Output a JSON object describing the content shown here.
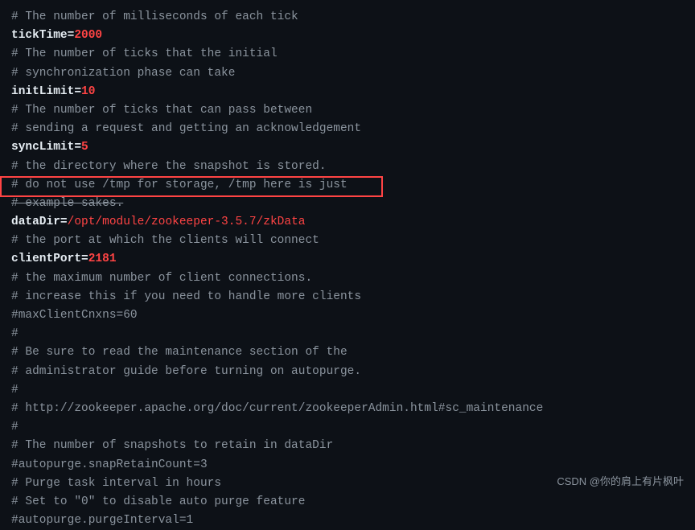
{
  "terminal": {
    "lines": [
      {
        "id": "line1",
        "type": "comment",
        "text": "# The number of milliseconds of each tick"
      },
      {
        "id": "line2",
        "type": "keyval",
        "key": "tickTime=",
        "value": "2000",
        "valueColor": "red"
      },
      {
        "id": "line3",
        "type": "comment",
        "text": "# The number of ticks that the initial"
      },
      {
        "id": "line4",
        "type": "comment",
        "text": "# synchronization phase can take"
      },
      {
        "id": "line5",
        "type": "keyval",
        "key": "initLimit=",
        "value": "10",
        "valueColor": "red"
      },
      {
        "id": "line6",
        "type": "comment",
        "text": "# The number of ticks that can pass between"
      },
      {
        "id": "line7",
        "type": "comment",
        "text": "# sending a request and getting an acknowledgement"
      },
      {
        "id": "line8",
        "type": "keyval",
        "key": "syncLimit=",
        "value": "5",
        "valueColor": "red"
      },
      {
        "id": "line9",
        "type": "comment",
        "text": "# the directory where the snapshot is stored."
      },
      {
        "id": "line10",
        "type": "comment",
        "text": "# do not use /tmp for storage, /tmp here is just"
      },
      {
        "id": "line11",
        "type": "comment-strike",
        "text": "# example sakes."
      },
      {
        "id": "line12",
        "type": "datadir",
        "key": "dataDir=",
        "value": "/opt/module/zookeeper-3.5.7/zkData"
      },
      {
        "id": "line13",
        "type": "comment",
        "text": "# the port at which the clients will connect"
      },
      {
        "id": "line14",
        "type": "keyval",
        "key": "clientPort=",
        "value": "2181",
        "valueColor": "red"
      },
      {
        "id": "line15",
        "type": "comment",
        "text": "# the maximum number of client connections."
      },
      {
        "id": "line16",
        "type": "comment",
        "text": "# increase this if you need to handle more clients"
      },
      {
        "id": "line17",
        "type": "keyval-comment",
        "key": "#maxClientCnxns=",
        "value": "60",
        "valueColor": "none"
      },
      {
        "id": "line18",
        "type": "comment",
        "text": "#"
      },
      {
        "id": "line19",
        "type": "comment-hash-bold",
        "text": "# Be sure to read the maintenance section of the"
      },
      {
        "id": "line20",
        "type": "comment",
        "text": "# administrator guide before turning on autopurge."
      },
      {
        "id": "line21",
        "type": "comment",
        "text": "#"
      },
      {
        "id": "line22",
        "type": "comment",
        "text": "# http://zookeeper.apache.org/doc/current/zookeeperAdmin.html#sc_maintenance"
      },
      {
        "id": "line23",
        "type": "comment",
        "text": "#"
      },
      {
        "id": "line24",
        "type": "comment",
        "text": "# The number of snapshots to retain in dataDir"
      },
      {
        "id": "line25",
        "type": "keyval-comment",
        "key": "#autopurge.snapRetainCount=",
        "value": "3"
      },
      {
        "id": "line26",
        "type": "comment",
        "text": "# Purge task interval in hours"
      },
      {
        "id": "line27",
        "type": "comment",
        "text": "# Set to \"0\" to disable auto purge feature"
      },
      {
        "id": "line28",
        "type": "keyval-comment",
        "key": "#autopurge.purgeInterval=",
        "value": "1"
      }
    ],
    "watermark": "CSDN @你的肩上有片枫叶"
  }
}
